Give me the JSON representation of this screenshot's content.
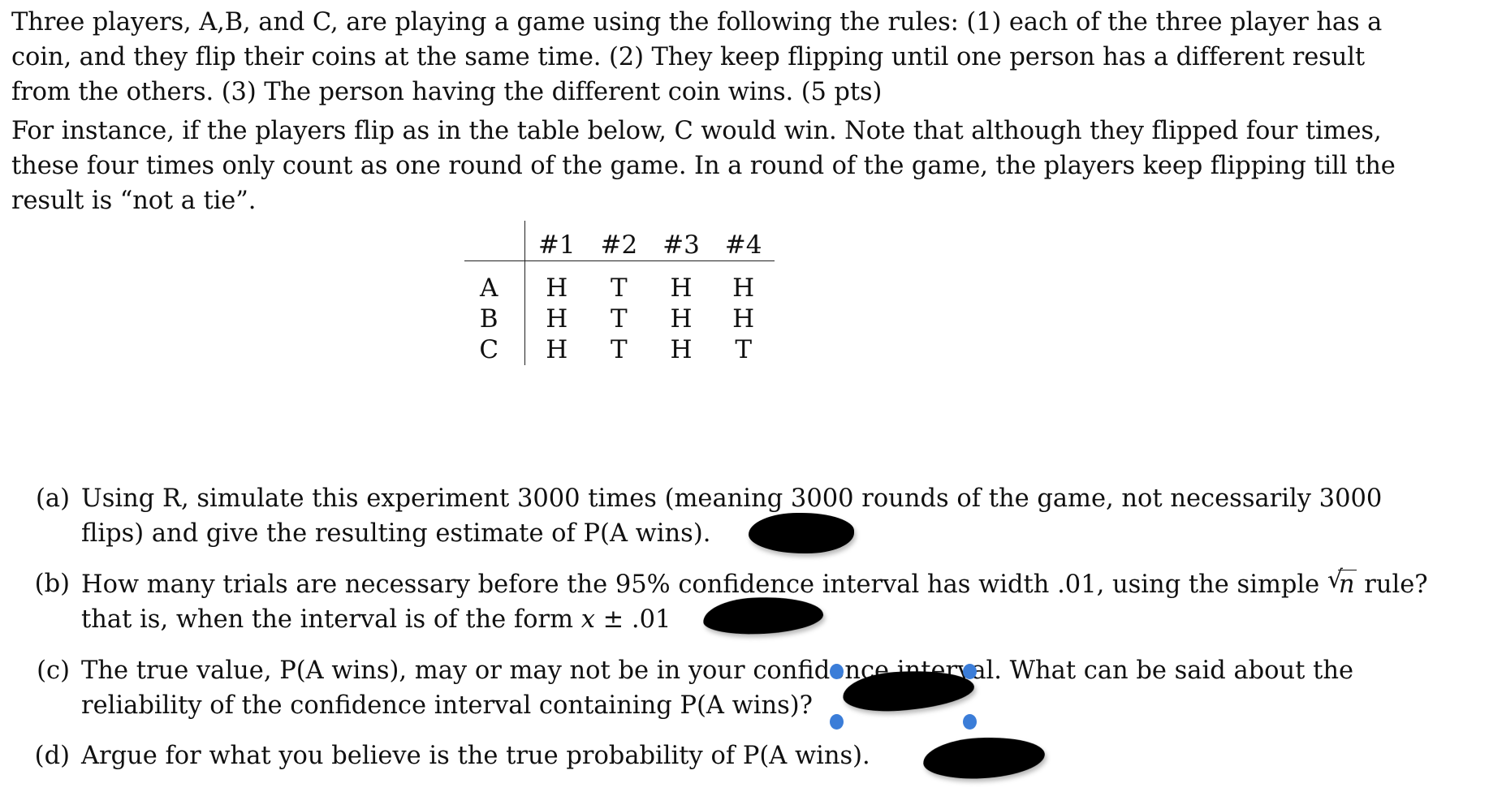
{
  "document": {
    "paragraphs": [
      {
        "id": "rules",
        "lines": [
          "Three players, A,B, and C, are playing a game using the following the rules: (1) each of the three player has a",
          "coin, and they flip their coins at the same time. (2) They keep flipping until one person has a different result",
          "from the others. (3) The person having the different coin wins. (5 pts)"
        ]
      },
      {
        "id": "example",
        "lines": [
          "For instance, if the players flip as in the table below, C would win. Note that although they flipped four times,",
          "these four times only count as one round of the game. In a round of the game, the players keep flipping till the",
          "result is “not a tie”."
        ]
      }
    ],
    "flip_table": {
      "corner_label": "",
      "columns": [
        "#1",
        "#2",
        "#3",
        "#4"
      ],
      "rows": [
        {
          "label": "A",
          "cells": [
            "H",
            "T",
            "H",
            "H"
          ]
        },
        {
          "label": "B",
          "cells": [
            "H",
            "T",
            "H",
            "H"
          ]
        },
        {
          "label": "C",
          "cells": [
            "H",
            "T",
            "H",
            "T"
          ]
        }
      ]
    },
    "items": [
      {
        "marker": "(a)",
        "lines": [
          "Using R, simulate this experiment 3000 times (meaning 3000 rounds of the game, not necessarily 3000",
          "flips) and give the resulting estimate of P(A wins)."
        ]
      },
      {
        "marker": "(b)",
        "lines_pre": "How many trials are necessary before the 95% confidence interval has width .01, using the simple ",
        "sqrt_radicand": "n",
        "lines_post": " rule?",
        "line2_pre": "that is, when the interval is of the form ",
        "line2_var": "x",
        "line2_post": " ± .01"
      },
      {
        "marker": "(c)",
        "lines": [
          "The true value, P(A wins), may or may not be in your confidence interval. What can be said about the",
          "reliability of the confidence interval containing P(A wins)?"
        ]
      },
      {
        "marker": "(d)",
        "lines": [
          "Argue for what you believe is the true probability of P(A wins)."
        ]
      }
    ],
    "annotations": {
      "redaction_color": "#000000",
      "selection_handle_color": "#3b7dd8",
      "redaction_count": 4,
      "selected_redaction_index": 3
    }
  }
}
